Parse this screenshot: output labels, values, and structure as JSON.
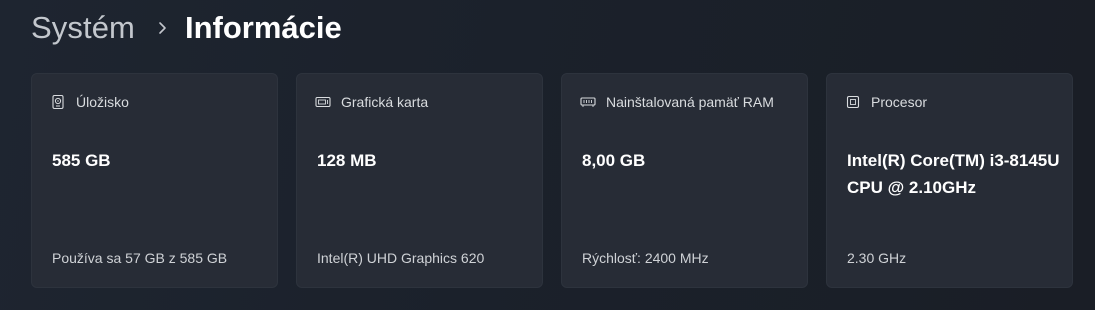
{
  "breadcrumb": {
    "parent": "Systém",
    "current": "Informácie"
  },
  "cards": [
    {
      "icon": "storage-icon",
      "title": "Úložisko",
      "value": "585 GB",
      "detail": "Používa sa 57 GB z 585 GB"
    },
    {
      "icon": "graphics-card-icon",
      "title": "Grafická karta",
      "value": "128 MB",
      "detail": "Intel(R) UHD Graphics 620"
    },
    {
      "icon": "ram-icon",
      "title": "Nainštalovaná pamäť RAM",
      "value": "8,00 GB",
      "detail": "Rýchlosť: 2400 MHz"
    },
    {
      "icon": "processor-icon",
      "title": "Procesor",
      "value": "Intel(R) Core(TM) i3-8145U CPU @ 2.10GHz",
      "detail": "2.30 GHz"
    }
  ]
}
